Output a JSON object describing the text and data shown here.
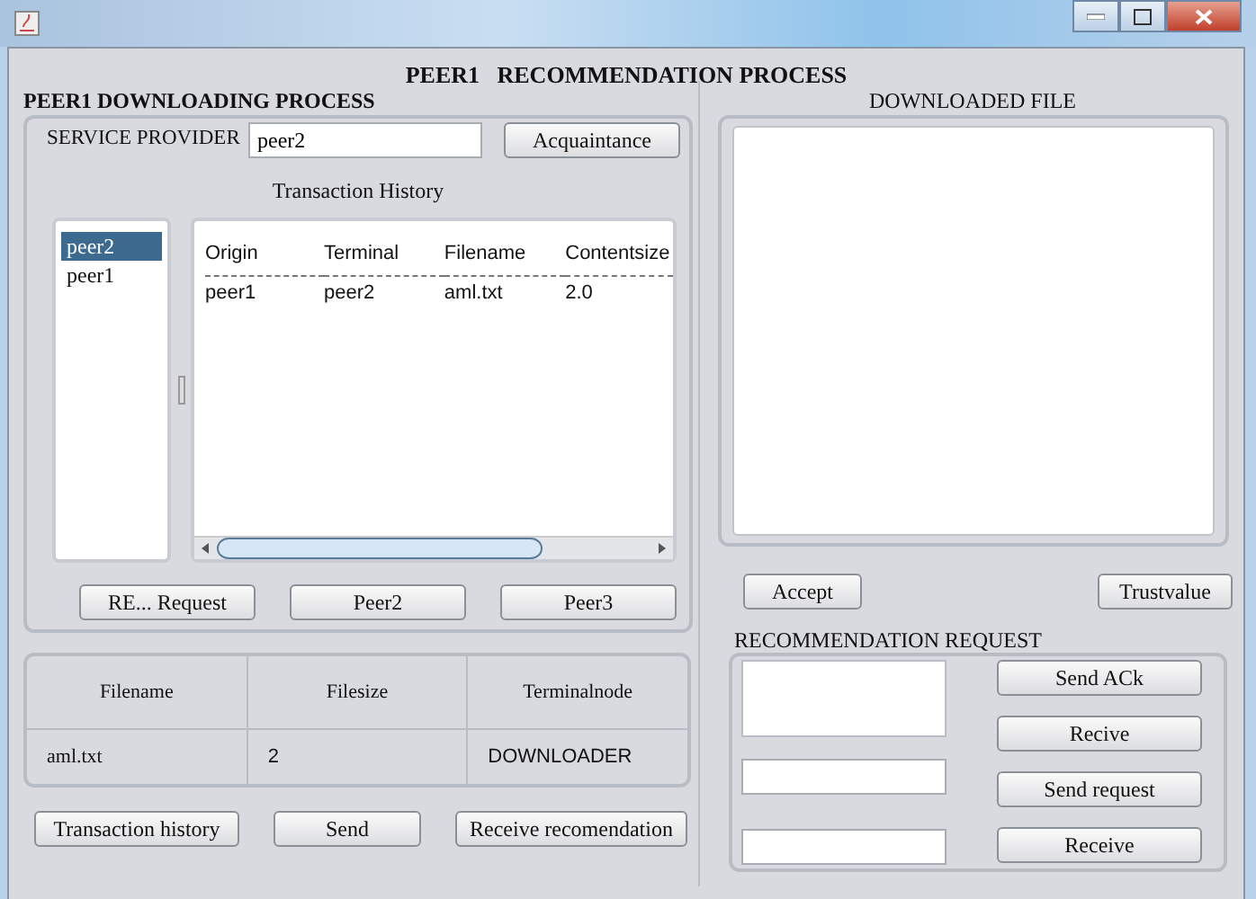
{
  "heading": "PEER1   RECOMMENDATION PROCESS",
  "downloading": {
    "title": "PEER1 DOWNLOADING PROCESS",
    "provider_label": "SERVICE PROVIDER",
    "provider_value": "peer2",
    "acquaintance_button": "Acquaintance",
    "history_label": "Transaction History",
    "peers": [
      {
        "label": "peer2",
        "selected": true
      },
      {
        "label": "peer1",
        "selected": false
      }
    ],
    "history_table": {
      "columns": [
        "Origin",
        "Terminal",
        "Filename",
        "Contentsize"
      ],
      "rows": [
        [
          "peer1",
          "peer2",
          "aml.txt",
          "2.0"
        ]
      ]
    },
    "buttons": [
      "RE... Request",
      "Peer2",
      "Peer3"
    ]
  },
  "file_table": {
    "columns": [
      "Filename",
      "Filesize",
      "Terminalnode"
    ],
    "rows": [
      [
        "aml.txt",
        "2",
        "DOWNLOADER"
      ]
    ]
  },
  "bottom_buttons": [
    "Transaction history",
    "Send",
    "Receive recomendation"
  ],
  "downloaded_file": {
    "label": "DOWNLOADED FILE",
    "buttons": [
      "Accept",
      "Trustvalue"
    ]
  },
  "recommendation_request": {
    "title": "RECOMMENDATION REQUEST",
    "buttons": [
      "Send ACk",
      "Recive",
      "Send request",
      "Receive"
    ]
  }
}
